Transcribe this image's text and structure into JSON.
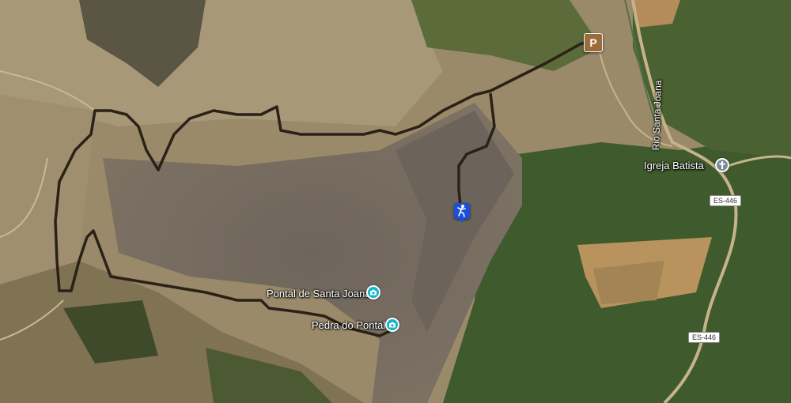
{
  "map": {
    "labels": {
      "pontal_santa_joana": "Pontal de Santa Joana",
      "pedra_do_pontal": "Pedra do Pontal",
      "igreja_batista": "Igreja Batista",
      "rio_santa_joana": "Rio Santa Joana",
      "road_es446_upper": "ES-446",
      "road_es446_lower": "ES-446",
      "parking": "P"
    },
    "icons": {
      "camera": "camera-icon",
      "church": "cross-icon",
      "parking": "parking-icon",
      "climbing": "climbing-icon"
    },
    "colors": {
      "trail": "#2b2116",
      "poi": "#12b5cb",
      "climbing_marker": "#1a4fd6",
      "parking": "#9c6b3c"
    }
  }
}
